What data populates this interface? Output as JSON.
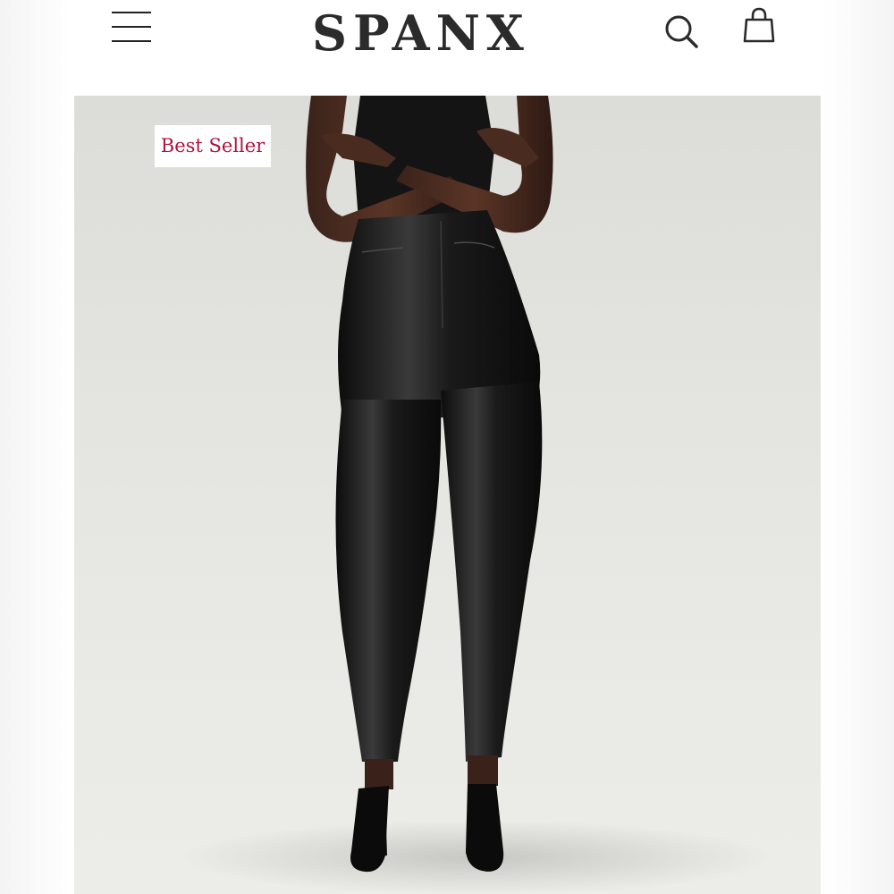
{
  "header": {
    "brand": "SPANX",
    "trademark": "®",
    "menu_icon": "hamburger-menu-icon",
    "search_icon": "search-icon",
    "bag_icon": "shopping-bag-icon"
  },
  "product": {
    "badge": "Best Seller",
    "badge_color": "#b0103e"
  }
}
